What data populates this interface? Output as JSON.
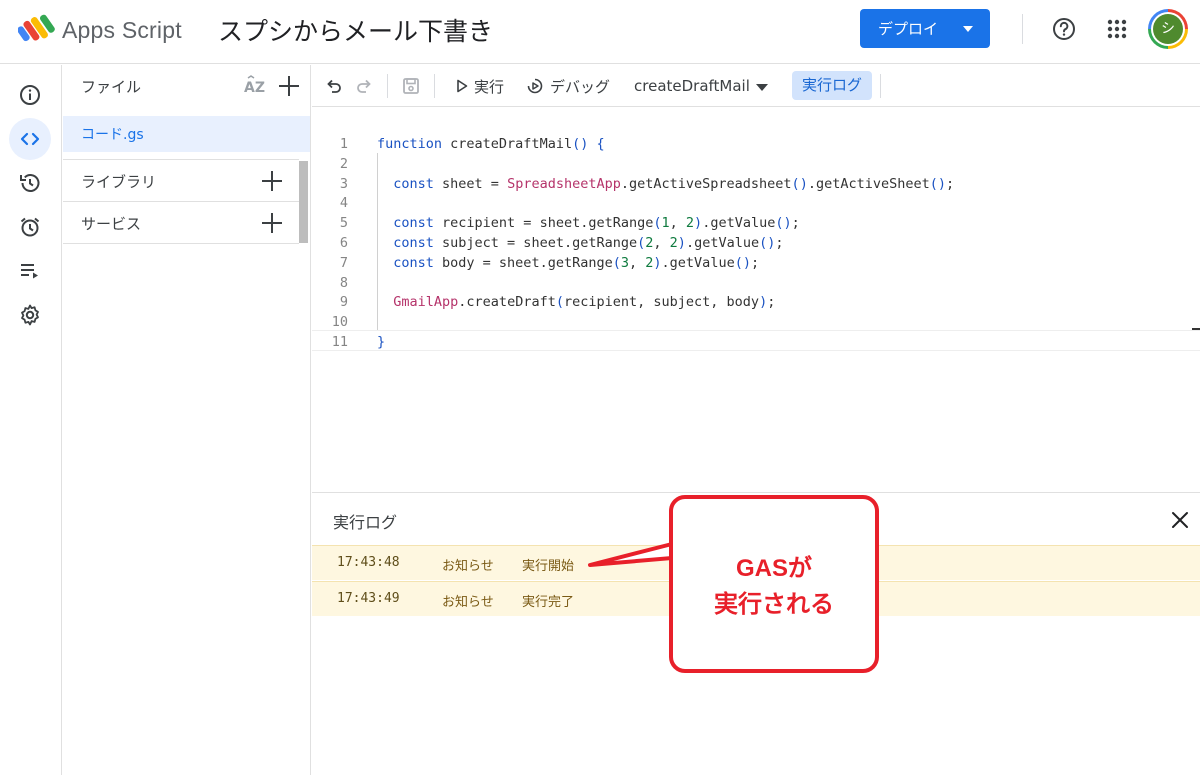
{
  "header": {
    "app_name": "Apps Script",
    "project_title": "スプシからメール下書き",
    "deploy_label": "デプロイ",
    "avatar_initial": "シ",
    "accent": "#1a73e8"
  },
  "rail": {
    "items": [
      "info-icon",
      "code-icon",
      "history-icon",
      "alarm-icon",
      "executions-icon",
      "settings-icon"
    ],
    "active": "code-icon"
  },
  "files": {
    "title": "ファイル",
    "items": [
      {
        "name": "コード.gs"
      }
    ],
    "sections": [
      {
        "label": "ライブラリ"
      },
      {
        "label": "サービス"
      }
    ]
  },
  "toolbar": {
    "run_label": "実行",
    "debug_label": "デバッグ",
    "function_name": "createDraftMail",
    "log_label": "実行ログ"
  },
  "editor": {
    "lines": [
      {
        "n": "1",
        "text": "function createDraftMail() {"
      },
      {
        "n": "2",
        "text": ""
      },
      {
        "n": "3",
        "text": "  const sheet = SpreadsheetApp.getActiveSpreadsheet().getActiveSheet();"
      },
      {
        "n": "4",
        "text": ""
      },
      {
        "n": "5",
        "text": "  const recipient = sheet.getRange(1, 2).getValue();"
      },
      {
        "n": "6",
        "text": "  const subject = sheet.getRange(2, 2).getValue();"
      },
      {
        "n": "7",
        "text": "  const body = sheet.getRange(3, 2).getValue();"
      },
      {
        "n": "8",
        "text": ""
      },
      {
        "n": "9",
        "text": "  GmailApp.createDraft(recipient, subject, body);"
      },
      {
        "n": "10",
        "text": ""
      },
      {
        "n": "11",
        "text": "}"
      }
    ]
  },
  "log": {
    "title": "実行ログ",
    "rows": [
      {
        "time": "17:43:48",
        "level": "お知らせ",
        "message": "実行開始"
      },
      {
        "time": "17:43:49",
        "level": "お知らせ",
        "message": "実行完了"
      }
    ]
  },
  "callout": {
    "line1": "GASが",
    "line2": "実行される",
    "color": "#e8202a"
  }
}
